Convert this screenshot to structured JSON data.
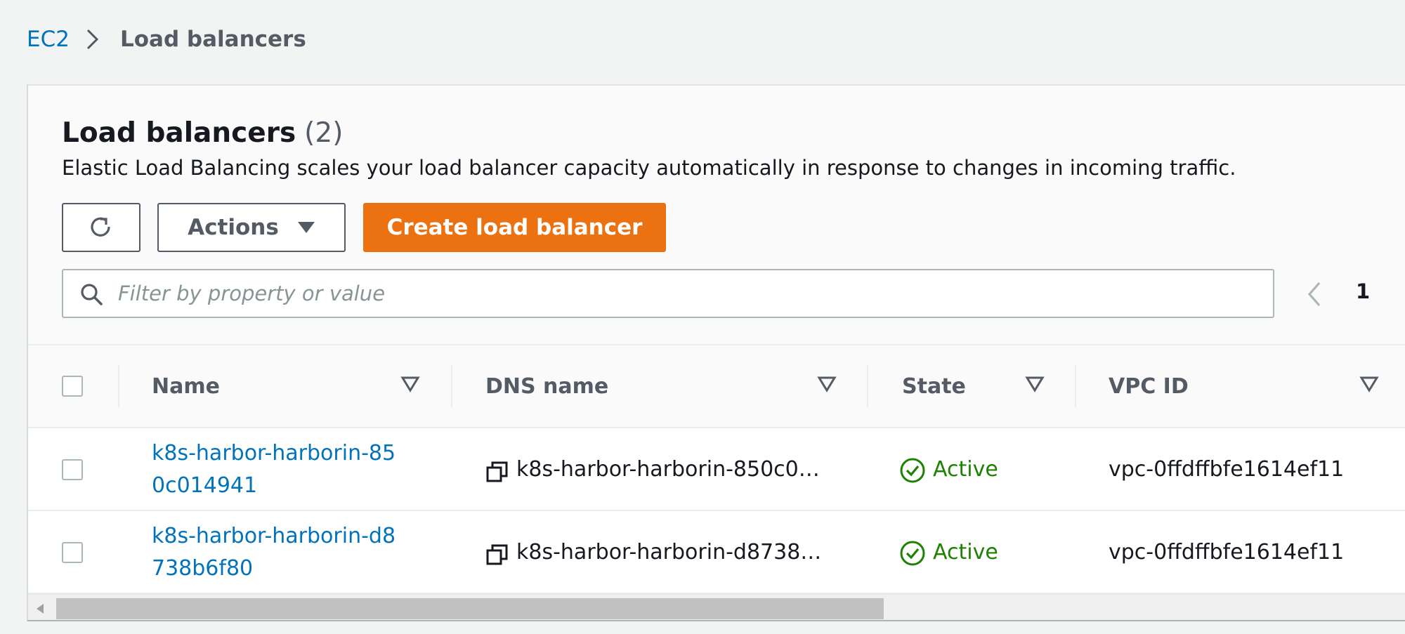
{
  "breadcrumb": {
    "parent": "EC2",
    "current": "Load balancers"
  },
  "panel": {
    "title": "Load balancers",
    "count": "(2)",
    "description": "Elastic Load Balancing scales your load balancer capacity automatically in response to changes in incoming traffic."
  },
  "toolbar": {
    "refresh_icon": "refresh-icon",
    "actions_label": "Actions",
    "create_label": "Create load balancer"
  },
  "search": {
    "placeholder": "Filter by property or value",
    "value": ""
  },
  "pagination": {
    "current_page": "1"
  },
  "table": {
    "columns": [
      {
        "label": "Name"
      },
      {
        "label": "DNS name"
      },
      {
        "label": "State"
      },
      {
        "label": "VPC ID"
      }
    ],
    "rows": [
      {
        "name": "k8s-harbor-harborin-850c014941",
        "dns": "k8s-harbor-harborin-850c0…",
        "state": "Active",
        "vpc": "vpc-0ffdffbfe1614ef11"
      },
      {
        "name": "k8s-harbor-harborin-d8738b6f80",
        "dns": "k8s-harbor-harborin-d8738…",
        "state": "Active",
        "vpc": "vpc-0ffdffbfe1614ef11"
      }
    ]
  },
  "colors": {
    "link": "#0073bb",
    "primary_button": "#ec7211",
    "status_active": "#1d8102",
    "page_background": "#f2f3f3"
  }
}
